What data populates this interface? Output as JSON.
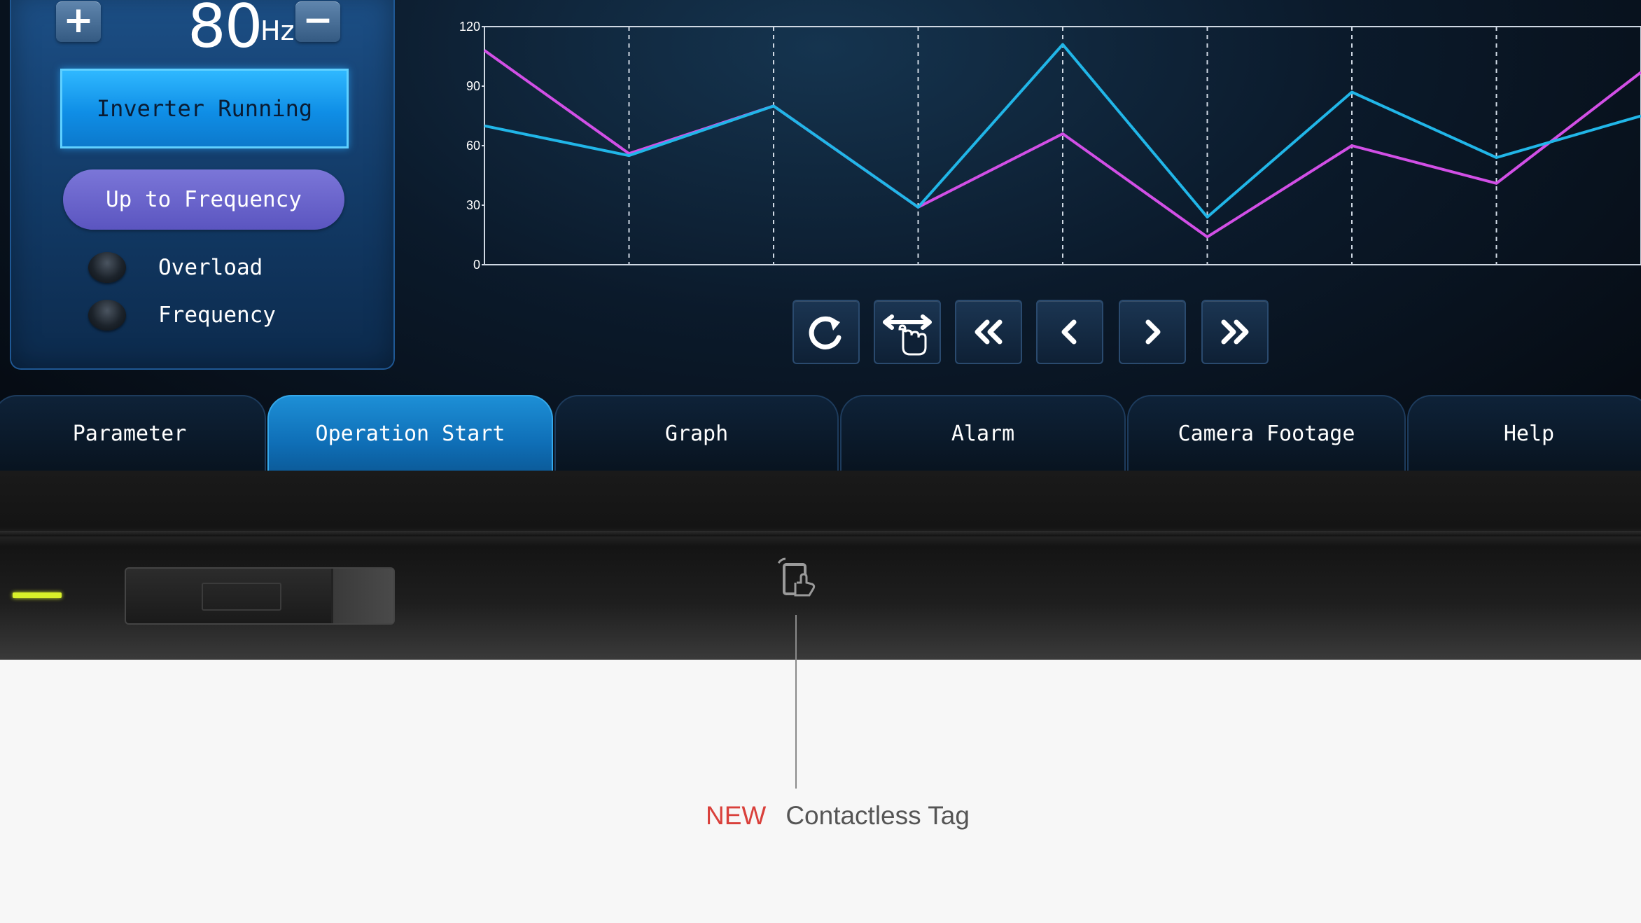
{
  "control_panel": {
    "plus_label": "+",
    "minus_label": "−",
    "frequency_value": "80",
    "frequency_unit": "Hz",
    "inverter_button": "Inverter Running",
    "up_to_frequency_button": "Up to Frequency",
    "indicators": [
      {
        "label": "Overload",
        "state": "off"
      },
      {
        "label": "Frequency",
        "state": "off"
      }
    ]
  },
  "chart_data": {
    "type": "line",
    "x": [
      0,
      1,
      2,
      3,
      4,
      5,
      6,
      7,
      8
    ],
    "yticks": [
      0,
      30,
      60,
      90,
      120
    ],
    "ylim": [
      0,
      120
    ],
    "grid": "vertical dashed",
    "series": [
      {
        "color": "#d24fe6",
        "values": [
          108,
          56,
          80,
          29,
          66,
          14,
          60,
          41,
          97
        ]
      },
      {
        "color": "#21b6e8",
        "values": [
          70,
          55,
          80,
          29,
          111,
          24,
          87,
          54,
          75
        ]
      }
    ]
  },
  "controls": [
    {
      "icon": "refresh-icon"
    },
    {
      "icon": "swipe-hand-icon"
    },
    {
      "icon": "double-chevron-left-icon"
    },
    {
      "icon": "chevron-left-icon"
    },
    {
      "icon": "chevron-right-icon"
    },
    {
      "icon": "double-chevron-right-icon"
    }
  ],
  "tabs": [
    {
      "label": "Parameter",
      "active": false
    },
    {
      "label": "Operation Start",
      "active": true
    },
    {
      "label": "Graph",
      "active": false
    },
    {
      "label": "Alarm",
      "active": false
    },
    {
      "label": "Camera Footage",
      "active": false
    },
    {
      "label": "Help",
      "active": false
    }
  ],
  "device": {
    "status_led_color": "#d8f02a",
    "tag_icon": "contactless-tag-icon"
  },
  "callout": {
    "badge": "NEW",
    "text": "Contactless Tag"
  }
}
